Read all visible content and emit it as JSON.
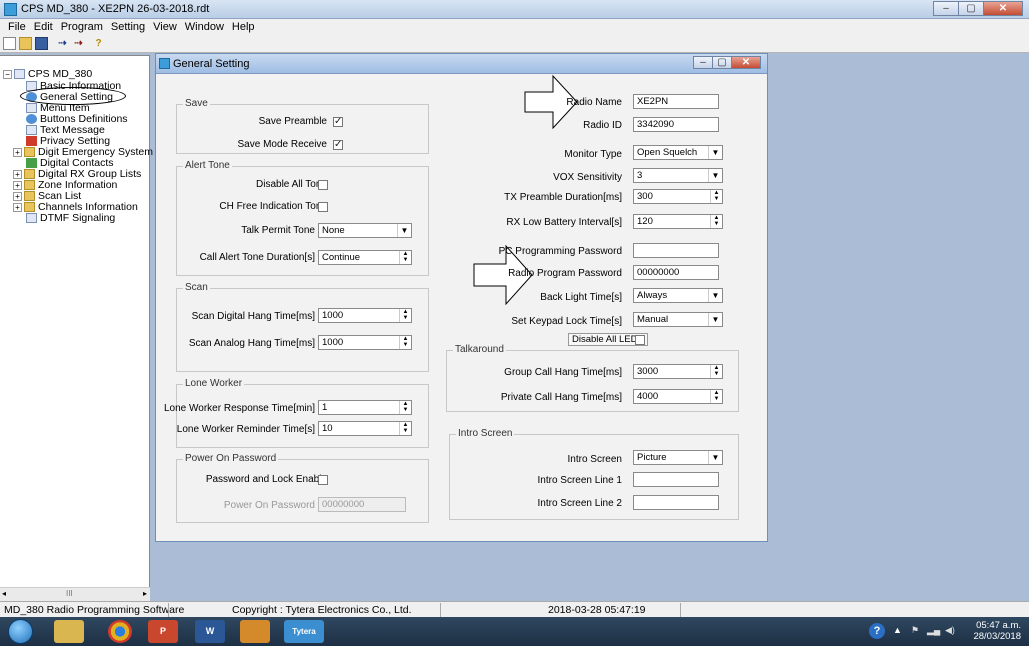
{
  "window": {
    "title": "CPS MD_380 - XE2PN 26-03-2018.rdt",
    "min": "–",
    "max": "▢",
    "close": "✕"
  },
  "menu": [
    "File",
    "Edit",
    "Program",
    "Setting",
    "View",
    "Window",
    "Help"
  ],
  "tree": {
    "root": "CPS MD_380",
    "items": [
      "Basic Information",
      "General Setting",
      "Menu Item",
      "Buttons Definitions",
      "Text Message",
      "Privacy Setting",
      "Digit Emergency System",
      "Digital Contacts",
      "Digital RX Group Lists",
      "Zone Information",
      "Scan List",
      "Channels Information",
      "DTMF Signaling"
    ],
    "scroll_label": "III"
  },
  "child": {
    "title": "General Setting",
    "save": {
      "group": "Save",
      "preamble": "Save Preamble",
      "mode_receive": "Save Mode Receive",
      "check": "✓"
    },
    "alert": {
      "group": "Alert Tone",
      "disable_all": "Disable All Tone",
      "ch_free": "CH Free Indication Tone",
      "talk_permit": "Talk Permit Tone",
      "talk_permit_value": "None",
      "call_alert": "Call Alert Tone Duration[s]",
      "call_alert_value": "Continue"
    },
    "scan": {
      "group": "Scan",
      "digital": "Scan Digital Hang Time[ms]",
      "digital_value": "1000",
      "analog": "Scan Analog Hang Time[ms]",
      "analog_value": "1000"
    },
    "lone": {
      "group": "Lone Worker",
      "response": "Lone Worker Response Time[min]",
      "response_value": "1",
      "reminder": "Lone Worker Reminder Time[s]",
      "reminder_value": "10"
    },
    "power": {
      "group": "Power On Password",
      "enable": "Password and Lock Enable",
      "password": "Power On Password",
      "password_value": "00000000"
    },
    "right": {
      "radio_name": "Radio Name",
      "radio_name_value": "XE2PN",
      "radio_id": "Radio ID",
      "radio_id_value": "3342090",
      "monitor": "Monitor Type",
      "monitor_value": "Open Squelch",
      "vox": "VOX Sensitivity",
      "vox_value": "3",
      "tx_preamble": "TX Preamble Duration[ms]",
      "tx_preamble_value": "300",
      "rx_low": "RX Low Battery Interval[s]",
      "rx_low_value": "120",
      "pc_pw": "PC Programming Password",
      "pc_pw_value": "",
      "radio_pw": "Radio Program Password",
      "radio_pw_value": "00000000",
      "backlight": "Back Light Time[s]",
      "backlight_value": "Always",
      "keypad": "Set Keypad Lock Time[s]",
      "keypad_value": "Manual",
      "disable_leds": "Disable All LEDS"
    },
    "talkaround": {
      "group": "Talkaround",
      "group_call": "Group Call Hang Time[ms]",
      "group_call_value": "3000",
      "private_call": "Private Call Hang Time[ms]",
      "private_call_value": "4000"
    },
    "intro": {
      "group": "Intro Screen",
      "screen": "Intro Screen",
      "screen_value": "Picture",
      "line1": "Intro Screen Line 1",
      "line1_value": "",
      "line2": "Intro Screen Line 2",
      "line2_value": ""
    }
  },
  "status": {
    "app": "MD_380 Radio Programming Software",
    "copyright": "Copyright : Tytera Electronics Co., Ltd.",
    "datetime": "2018-03-28 05:47:19"
  },
  "taskbar": {
    "tytera": "Tytera",
    "word": "W",
    "ppt": "P",
    "time": "05:47 a.m.",
    "date": "28/03/2018"
  },
  "colors": {
    "desktop": "#abbdd6",
    "titlebar": "#b9cde6",
    "close": "#c34c33",
    "taskbar": "#1d2f44"
  }
}
